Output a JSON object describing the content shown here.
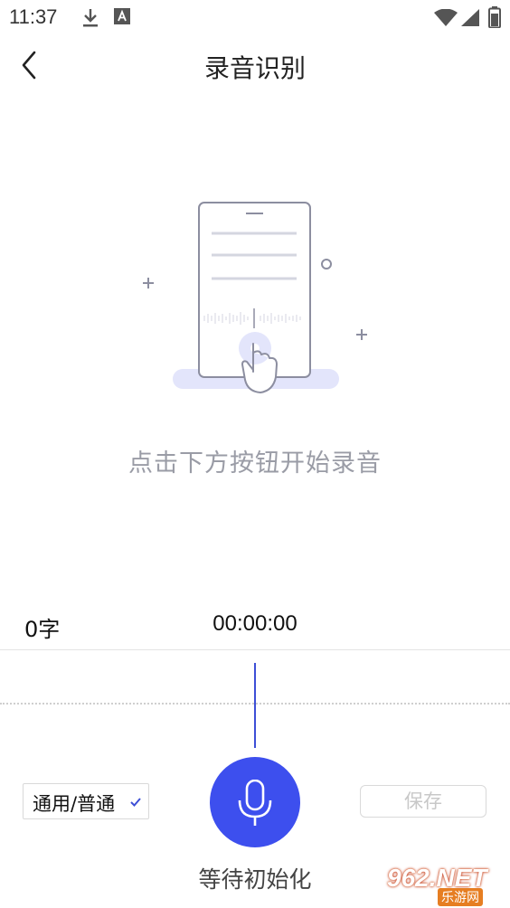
{
  "status_bar": {
    "time": "11:37",
    "icons": [
      "download-icon",
      "accessibility-icon",
      "wifi-icon",
      "signal-icon",
      "battery-icon"
    ]
  },
  "header": {
    "title": "录音识别",
    "back_icon": "back-chevron-icon"
  },
  "empty_state": {
    "hint": "点击下方按钮开始录音"
  },
  "recording": {
    "char_count": "0字",
    "timer": "00:00:00",
    "language": "通用/普通",
    "status": "等待初始化",
    "save_label": "保存"
  },
  "watermark": {
    "main": "962.NET",
    "sub": "乐游网"
  },
  "colors": {
    "accent": "#3d4fee",
    "hint_text": "#9a9ca6",
    "illustration_stroke": "#8c8ea0",
    "illustration_fill": "#e3e5fb"
  }
}
